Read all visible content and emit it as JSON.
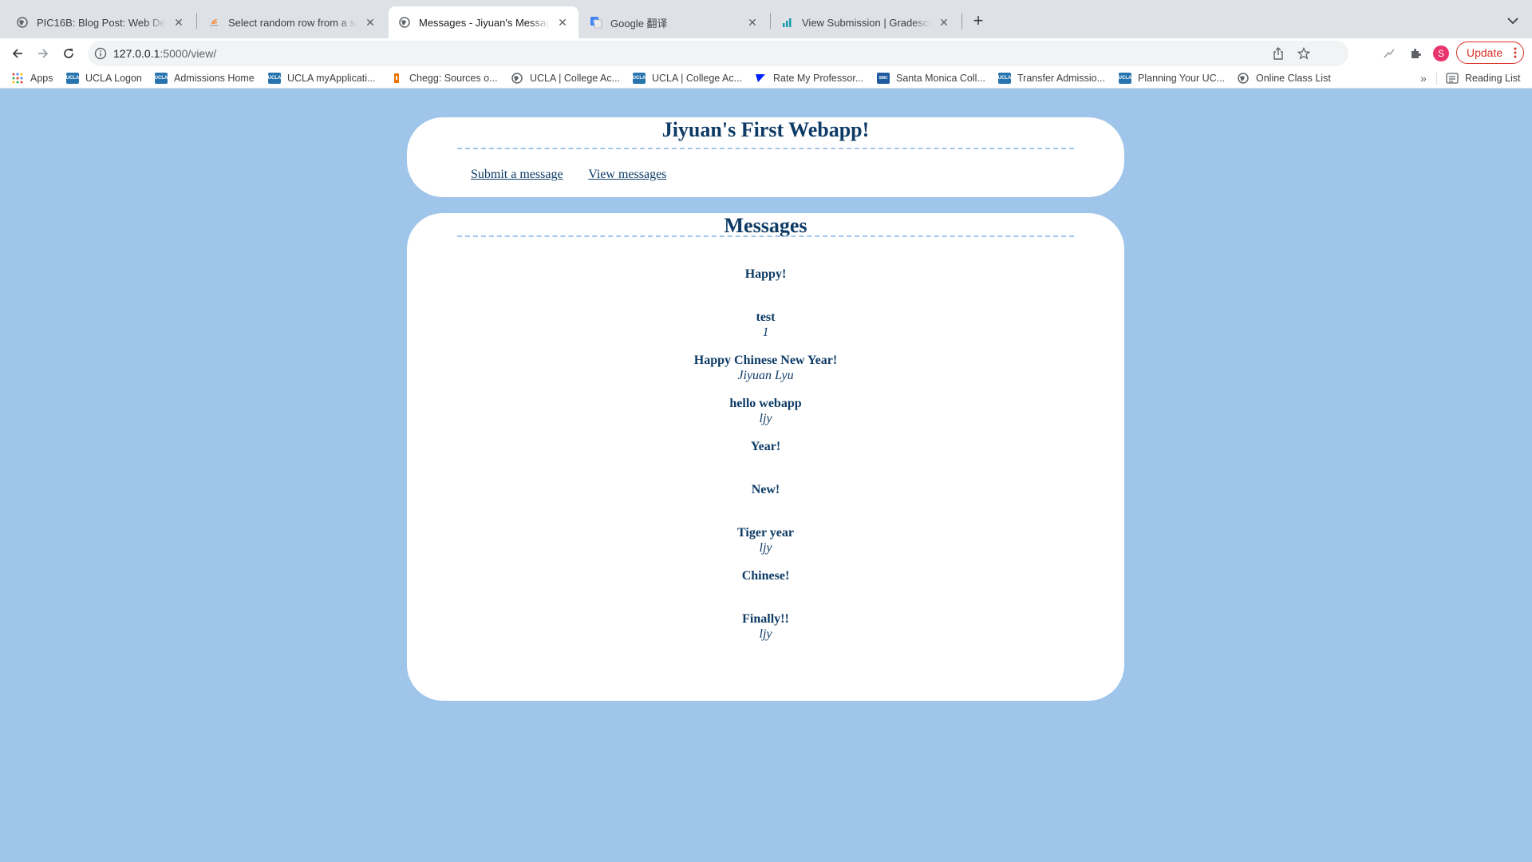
{
  "browser": {
    "tabs": [
      {
        "title": "PIC16B: Blog Post: Web Develo",
        "icon": "globe-icon",
        "active": false
      },
      {
        "title": "Select random row from a sqlit",
        "icon": "stackoverflow-icon",
        "active": false
      },
      {
        "title": "Messages - Jiyuan's Message",
        "icon": "globe-icon",
        "active": true
      },
      {
        "title": "Google 翻译",
        "icon": "google-translate-icon",
        "active": false
      },
      {
        "title": "View Submission | Gradescope",
        "icon": "gradescope-icon",
        "active": false
      }
    ],
    "url_host": "127.0.0.1",
    "url_rest": ":5000/view/",
    "avatar_initial": "S",
    "update_label": "Update",
    "bookmarks": [
      {
        "label": "Apps",
        "icon": "apps-grid-icon"
      },
      {
        "label": "UCLA Logon",
        "icon": "ucla-icon"
      },
      {
        "label": "Admissions Home",
        "icon": "ucla-icon"
      },
      {
        "label": "UCLA myApplicati...",
        "icon": "ucla-icon"
      },
      {
        "label": "Chegg: Sources o...",
        "icon": "chegg-icon"
      },
      {
        "label": "UCLA | College Ac...",
        "icon": "globe-icon"
      },
      {
        "label": "UCLA | College Ac...",
        "icon": "ucla-icon"
      },
      {
        "label": "Rate My Professor...",
        "icon": "ratemyprofessor-icon"
      },
      {
        "label": "Santa Monica Coll...",
        "icon": "smc-icon"
      },
      {
        "label": "Transfer Admissio...",
        "icon": "ucla-icon"
      },
      {
        "label": "Planning Your UC...",
        "icon": "ucla-icon"
      },
      {
        "label": "Online Class List",
        "icon": "globe-icon"
      }
    ],
    "reading_list_label": "Reading List",
    "colors": {
      "tabstrip": "#dee1e6",
      "update": "#d93025",
      "avatar": "#e8336d"
    }
  },
  "page": {
    "site_title": "Jiyuan's First Webapp!",
    "nav": {
      "submit_label": "Submit a message",
      "view_label": "View messages"
    },
    "messages_title": "Messages",
    "messages": [
      {
        "text": "Happy!",
        "handle": ""
      },
      {
        "text": "test",
        "handle": "1"
      },
      {
        "text": "Happy Chinese New Year!",
        "handle": "Jiyuan Lyu"
      },
      {
        "text": "hello webapp",
        "handle": "ljy"
      },
      {
        "text": "Year!",
        "handle": ""
      },
      {
        "text": "New!",
        "handle": ""
      },
      {
        "text": "Tiger year",
        "handle": "ljy"
      },
      {
        "text": "Chinese!",
        "handle": ""
      },
      {
        "text": "Finally!!",
        "handle": "ljy"
      }
    ],
    "colors": {
      "background": "#9fc5ea",
      "text": "#0d3b66",
      "card": "#ffffff"
    }
  }
}
